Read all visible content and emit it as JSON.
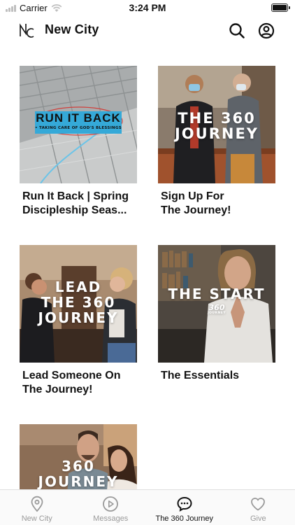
{
  "status_bar": {
    "carrier": "Carrier",
    "time": "3:24 PM"
  },
  "header": {
    "logo_text": "NC",
    "title": "New City"
  },
  "cards": [
    {
      "title": "Run It Back | Spring\nDiscipleship Seas...",
      "image_text": "RUN IT BACK",
      "image_subtext": "• TAKING CARE OF GOD'S BLESSINGS"
    },
    {
      "title": "Sign Up For\nThe Journey!",
      "image_text_line1": "THE 360",
      "image_text_line2": "JOURNEY"
    },
    {
      "title": "Lead Someone On\nThe Journey!",
      "image_text_line1": "LEAD",
      "image_text_line2": "THE 360",
      "image_text_line3": "JOURNEY"
    },
    {
      "title": "The Essentials",
      "image_text": "THE START",
      "image_subtext": "360",
      "image_subtext2": "JOURNEY"
    },
    {
      "title": "",
      "image_text_line1": "360",
      "image_text_line2": "JOURNEY"
    }
  ],
  "tabs": [
    {
      "label": "New City",
      "icon": "location-pin-icon",
      "active": false
    },
    {
      "label": "Messages",
      "icon": "play-circle-icon",
      "active": false
    },
    {
      "label": "The 360 Journey",
      "icon": "chat-bubble-icon",
      "active": true
    },
    {
      "label": "Give",
      "icon": "heart-icon",
      "active": false
    }
  ],
  "colors": {
    "active": "#111111",
    "inactive": "#9a9a9a",
    "banner_blue": "#35a9d8"
  }
}
